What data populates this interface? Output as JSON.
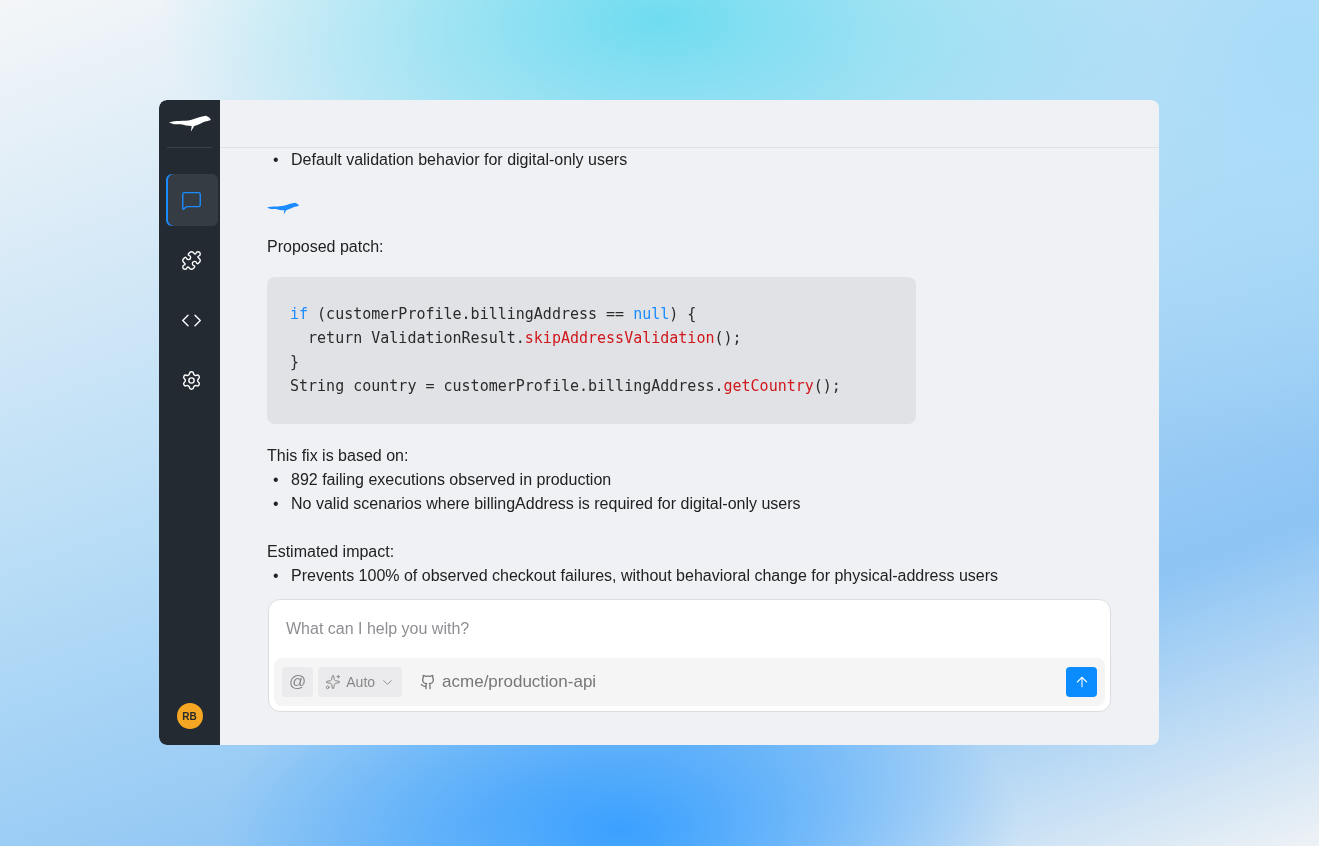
{
  "sidebar": {
    "items": [
      {
        "kind": "chat",
        "selected": true
      },
      {
        "kind": "extensions",
        "selected": false
      },
      {
        "kind": "code",
        "selected": false
      },
      {
        "kind": "settings",
        "selected": false
      }
    ],
    "avatar": "RB"
  },
  "messages": [
    {
      "kind": "bullets",
      "marker": "•",
      "items": [
        "Default validation behavior for digital-only users"
      ]
    },
    {
      "kind": "logo"
    },
    {
      "kind": "paragraph",
      "text": "Proposed patch:"
    },
    {
      "kind": "code",
      "lines": [
        [
          {
            "kind": "keyword",
            "text": "if"
          },
          {
            "kind": "plain",
            "text": " (customerProfile.billingAddress == "
          },
          {
            "kind": "keyword",
            "text": "null"
          },
          {
            "kind": "plain",
            "text": ") {"
          }
        ],
        [
          {
            "kind": "plain",
            "text": "  return ValidationResult."
          },
          {
            "kind": "method",
            "text": "skipAddressValidation"
          },
          {
            "kind": "plain",
            "text": "();"
          }
        ],
        [
          {
            "kind": "plain",
            "text": "}"
          }
        ],
        [
          {
            "kind": "plain",
            "text": "String country = customerProfile.billingAddress."
          },
          {
            "kind": "method",
            "text": "getCountry"
          },
          {
            "kind": "plain",
            "text": "();"
          }
        ]
      ]
    },
    {
      "kind": "heading",
      "text": "This fix is based on:"
    },
    {
      "kind": "bullets",
      "marker": "•",
      "items": [
        "892 failing executions observed in production",
        "No valid scenarios where billingAddress is required for digital-only users"
      ]
    },
    {
      "kind": "heading",
      "text": "Estimated impact:"
    },
    {
      "kind": "bullets",
      "marker": "•",
      "items": [
        "Prevents 100% of observed checkout failures, without behavioral change for physical-address users"
      ]
    }
  ],
  "composer": {
    "placeholder": "What can I help you with?",
    "mention": "@",
    "model": "Auto",
    "repo": "acme/production-api"
  }
}
